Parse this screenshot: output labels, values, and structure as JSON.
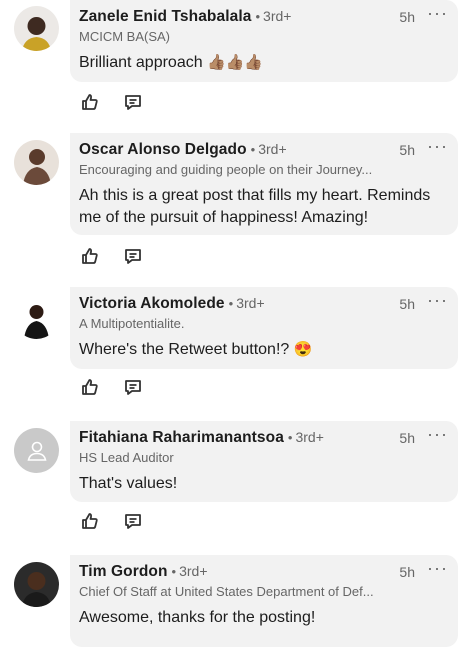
{
  "comments": [
    {
      "name": "Zanele Enid Tshabalala",
      "degree": "3rd+",
      "headline": "MCICM BA(SA)",
      "time": "5h",
      "text": "Brilliant approach",
      "emoji": "👍🏽👍🏽👍🏽",
      "avatar": "photo"
    },
    {
      "name": "Oscar Alonso Delgado",
      "degree": "3rd+",
      "headline": "Encouraging and guiding people on their Journey...",
      "time": "5h",
      "text_line1": "Ah this is a great post that fills my heart. Reminds",
      "text_line2": "me of the pursuit of happiness! Amazing!",
      "avatar": "photo"
    },
    {
      "name": "Victoria Akomolede",
      "degree": "3rd+",
      "headline": "A Multipotentialite.",
      "time": "5h",
      "text": "Where's the Retweet button!?",
      "emoji": "😍",
      "avatar": "photo"
    },
    {
      "name": "Fitahiana Raharimanantsoa",
      "degree": "3rd+",
      "headline": "HS Lead Auditor",
      "time": "5h",
      "text": "That's values!",
      "avatar": "placeholder"
    },
    {
      "name": "Tim Gordon",
      "degree": "3rd+",
      "headline": "Chief Of Staff at United States Department of Def...",
      "time": "5h",
      "text": "Awesome, thanks for the posting!",
      "avatar": "photo"
    }
  ],
  "icons": {
    "like": "thumbs-up-icon",
    "reply": "comment-icon",
    "more": "more-options-icon",
    "dot": "•",
    "more_glyph": "···"
  },
  "colors": {
    "bubble": "#f2f2f2",
    "secondary_text": "#666666",
    "primary_text": "#1d1d1d"
  }
}
